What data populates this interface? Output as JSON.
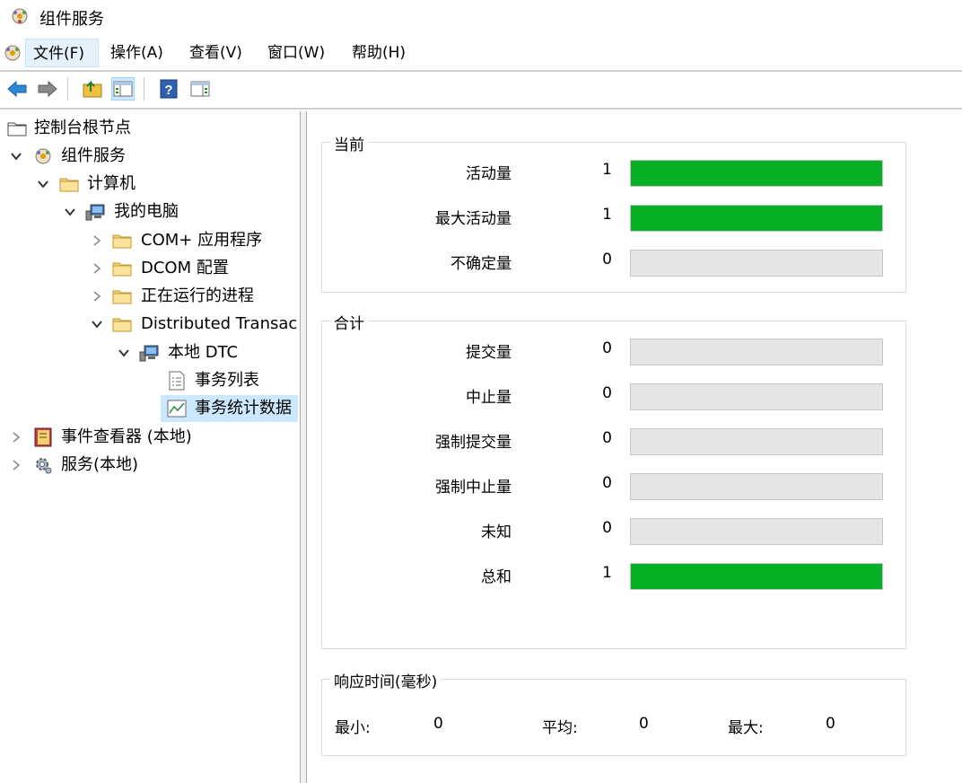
{
  "window": {
    "title": "组件服务"
  },
  "menu": [
    "文件(F)",
    "操作(A)",
    "查看(V)",
    "窗口(W)",
    "帮助(H)"
  ],
  "toolbar": [
    "back-icon",
    "forward-icon",
    "up-folder-icon",
    "show-tree-icon",
    "help-icon",
    "action-pane-icon"
  ],
  "tree": [
    {
      "label": "控制台根节点",
      "icon": "folder-icon"
    },
    {
      "label": "组件服务",
      "icon": "component-services-icon"
    },
    {
      "label": "计算机",
      "icon": "folder-icon"
    },
    {
      "label": "我的电脑",
      "icon": "computer-icon"
    },
    {
      "label": "COM+ 应用程序",
      "icon": "folder-icon"
    },
    {
      "label": "DCOM 配置",
      "icon": "folder-icon"
    },
    {
      "label": "正在运行的进程",
      "icon": "folder-icon"
    },
    {
      "label": "Distributed Transac",
      "icon": "folder-icon"
    },
    {
      "label": "本地 DTC",
      "icon": "computer-icon"
    },
    {
      "label": "事务列表",
      "icon": "list-icon"
    },
    {
      "label": "事务统计数据",
      "icon": "chart-icon"
    },
    {
      "label": "事件查看器 (本地)",
      "icon": "event-viewer-icon"
    },
    {
      "label": "服务(本地)",
      "icon": "gear-icon"
    }
  ],
  "stats": {
    "current": {
      "title": "当前",
      "rows": [
        {
          "label": "活动量",
          "value": "1",
          "fill": 1.0
        },
        {
          "label": "最大活动量",
          "value": "1",
          "fill": 1.0
        },
        {
          "label": "不确定量",
          "value": "0",
          "fill": 0
        }
      ]
    },
    "total": {
      "title": "合计",
      "rows": [
        {
          "label": "提交量",
          "value": "0",
          "fill": 0
        },
        {
          "label": "中止量",
          "value": "0",
          "fill": 0
        },
        {
          "label": "强制提交量",
          "value": "0",
          "fill": 0
        },
        {
          "label": "强制中止量",
          "value": "0",
          "fill": 0
        },
        {
          "label": "未知",
          "value": "0",
          "fill": 0
        },
        {
          "label": "总和",
          "value": "1",
          "fill": 1.0
        }
      ]
    },
    "response": {
      "title": "响应时间(毫秒)",
      "min_label": "最小:",
      "min_value": "0",
      "avg_label": "平均:",
      "avg_value": "0",
      "max_label": "最大:",
      "max_value": "0"
    }
  },
  "colors": {
    "bar_fill": "#06b025",
    "bar_empty": "#e6e6e6",
    "selection": "#cce8ff"
  }
}
